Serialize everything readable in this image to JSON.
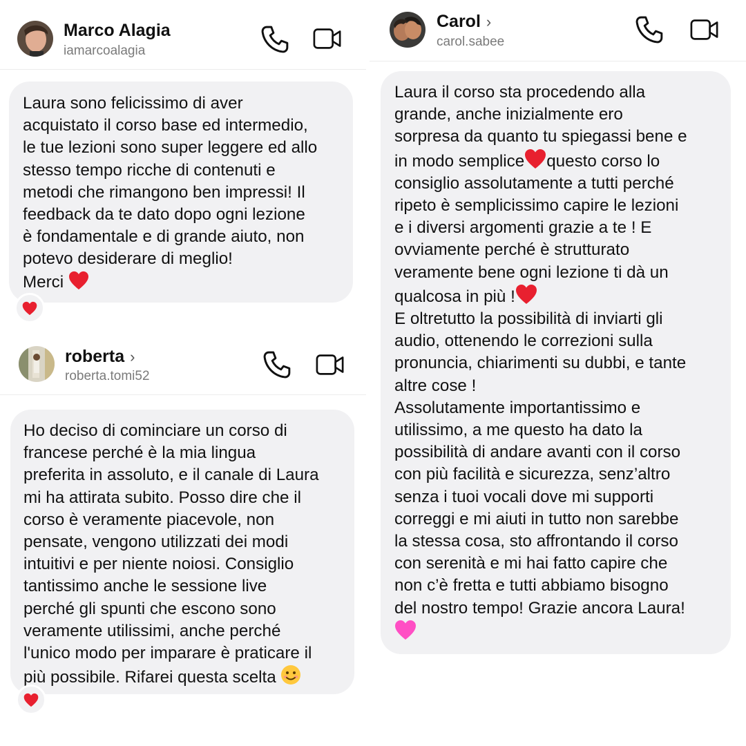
{
  "chats": [
    {
      "name": "Marco Alagia",
      "show_chevron": false,
      "handle": "iamarcoalagia",
      "message": "Laura sono felicissimo di aver\nacquistato il corso base ed intermedio,\nle tue lezioni sono super leggere ed allo\nstesso tempo ricche di contenuti e\nmetodi che rimangono ben impressi! Il\nfeedback da te dato dopo ogni lezione\nè fondamentale e di grande aiuto, non\npotevo desiderare di meglio!",
      "message_end": "Merci",
      "end_emoji": "red-heart",
      "reaction": "red-heart"
    },
    {
      "name": "roberta",
      "show_chevron": true,
      "chevron": "›",
      "handle": "roberta.tomi52",
      "message": "Ho deciso di cominciare un corso di\nfrancese perché è la mia lingua\npreferita in assoluto, e il canale di Laura\nmi ha attirata subito. Posso dire che il\ncorso è veramente piacevole, non\npensate, vengono utilizzati dei modi\nintuitivi e per niente noiosi. Consiglio\ntantissimo anche le sessione live\nperché gli spunti che escono sono\nveramente utilissimi, anche perché\nl'unico modo per imparare è praticare il\npiù possibile. Rifarei questa scelta",
      "end_emoji": "smiling-face",
      "reaction": "red-heart"
    },
    {
      "name": "Carol",
      "show_chevron": true,
      "chevron": "›",
      "handle": "carol.sabee",
      "message_part1": "Laura il corso sta procedendo alla\ngrande, anche inizialmente ero\nsorpresa da quanto tu spiegassi bene e\nin modo semplice",
      "message_part2": "questo corso lo\nconsiglio assolutamente a tutti perché\nripeto è semplicissimo capire le lezioni\ne i diversi argomenti grazie a te ! E\novviamente perché è strutturato\nveramente bene ogni lezione ti dà un\nqualcosa in più !",
      "message_part3": "E oltretutto la possibilità di inviarti gli\naudio, ottenendo le correzioni sulla\npronuncia, chiarimenti su dubbi, e tante\naltre cose !\nAssolutamente importantissimo e\nutilissimo, a me questo ha dato la\npossibilità di andare avanti con il corso\ncon più facilità e sicurezza, senz’altro\nsenza i tuoi vocali dove mi supporti\ncorreggi e mi aiuti in tutto non sarebbe\nla stessa cosa, sto affrontando il corso\ncon serenità e mi hai fatto capire che\nnon c’è fretta e tutti abbiamo bisogno\ndel nostro tempo! Grazie ancora Laura!",
      "end_emoji": "pink-heart"
    }
  ],
  "colors": {
    "bubble": "#f1f1f3",
    "red_heart": "#e8202f",
    "pink_heart": "#ff4fc4",
    "handle_text": "#7a7a7a"
  }
}
